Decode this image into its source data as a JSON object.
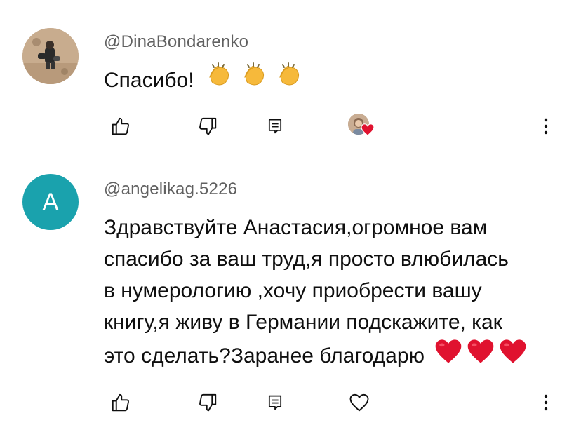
{
  "comments": [
    {
      "author": "@DinaBondarenko",
      "text": "Спасибо!",
      "emojis": [
        "clapping-hands",
        "clapping-hands",
        "clapping-hands"
      ],
      "creator_hearted": true
    },
    {
      "author": "@angelikag.5226",
      "avatar_letter": "A",
      "text_lines": [
        "Здравствуйте Анастасия,огромное вам",
        "спасибо за ваш труд,я просто влюбилась",
        "в нумерологию ,хочу приобрести вашу",
        "книгу,я живу в Германии подскажите, как",
        "это сделать?Заранее благодарю"
      ],
      "emojis": [
        "red-heart",
        "red-heart",
        "red-heart"
      ],
      "creator_hearted": false
    }
  ],
  "colors": {
    "author": "#606060",
    "text": "#0f0f0f",
    "avatar_letter_bg": "#1aa2ad",
    "heart_red": "#e0122f"
  }
}
